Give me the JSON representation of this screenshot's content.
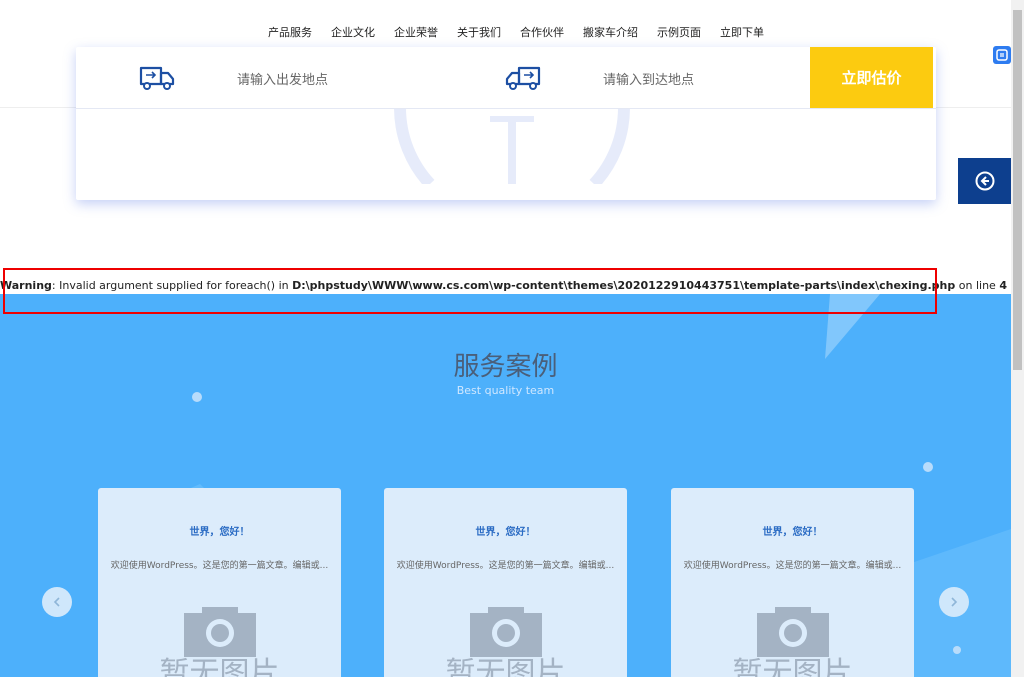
{
  "nav": {
    "items": [
      "产品服务",
      "企业文化",
      "企业荣誉",
      "关于我们",
      "合作伙伴",
      "搬家车介绍",
      "示例页面",
      "立即下单"
    ]
  },
  "quote": {
    "from_placeholder": "请输入出发地点",
    "to_placeholder": "请输入到达地点",
    "button_label": "立即估价"
  },
  "warning": {
    "label": "Warning",
    "message": ": Invalid argument supplied for foreach() in ",
    "path": "D:\\phpstudy\\WWW\\www.cs.com\\wp-content\\themes\\2020122910443751\\template-parts\\index\\chexing.php",
    "line_text": " on line ",
    "line": "4"
  },
  "section": {
    "title": "服务案例",
    "subtitle": "Best quality team"
  },
  "cards": [
    {
      "title": "世界，您好！",
      "excerpt": "欢迎使用WordPress。这是您的第一篇文章。编辑或...",
      "placeholder": "暂无图片"
    },
    {
      "title": "世界，您好！",
      "excerpt": "欢迎使用WordPress。这是您的第一篇文章。编辑或...",
      "placeholder": "暂无图片"
    },
    {
      "title": "世界，您好！",
      "excerpt": "欢迎使用WordPress。这是您的第一篇文章。编辑或...",
      "placeholder": "暂无图片"
    }
  ],
  "colors": {
    "accent_yellow": "#fccb10",
    "section_blue": "#4db0fb",
    "back_button": "#0d3f8e",
    "warning_border": "#e00000"
  },
  "icons": [
    "truck-icon",
    "back-circle-icon",
    "camera-icon",
    "chevron-left-icon",
    "chevron-right-icon",
    "side-widget-icon"
  ]
}
